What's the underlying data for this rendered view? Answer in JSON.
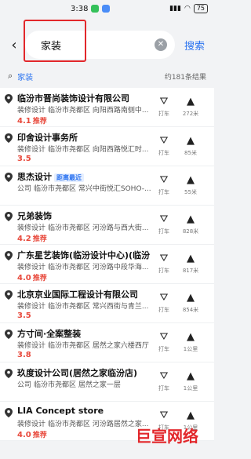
{
  "status_bar": {
    "time": "3:38",
    "battery": "75"
  },
  "search": {
    "query": "家装",
    "button_label": "搜索"
  },
  "suggestion": {
    "keyword": "家装",
    "count_text": "约181条结果"
  },
  "colors": {
    "accent": "#2b73f0",
    "rating": "#e8493c",
    "highlight": "#e2272b"
  },
  "results": [
    {
      "name": "临汾市晋尚装饰设计有限公司",
      "category": "装修设计",
      "address": "临汾市尧都区 向阳西路南侧中...",
      "tag": "",
      "rating": "4.1",
      "rec": "推荐",
      "taxi_label": "打车",
      "distance": "272米"
    },
    {
      "name": "印舍设计事务所",
      "category": "装修设计",
      "address": "临汾市尧都区 向阳西路悦汇时...",
      "tag": "",
      "rating": "3.5",
      "rec": "",
      "taxi_label": "打车",
      "distance": "85米"
    },
    {
      "name": "思杰设计",
      "category": "公司",
      "address": "临汾市尧都区 常兴中街悦汇SOHO-...",
      "tag": "距离最近",
      "rating": "",
      "rec": "",
      "taxi_label": "打车",
      "distance": "55米"
    },
    {
      "name": "兄弟装饰",
      "category": "装修设计",
      "address": "临汾市尧都区 河汾路与西大街...",
      "tag": "",
      "rating": "4.2",
      "rec": "推荐",
      "taxi_label": "打车",
      "distance": "828米"
    },
    {
      "name": "广东星艺装饰(临汾设计中心)(临汾...",
      "category": "装修设计",
      "address": "临汾市尧都区 河汾路中段华海...",
      "tag": "",
      "rating": "4.0",
      "rec": "推荐",
      "taxi_label": "打车",
      "distance": "817米"
    },
    {
      "name": "北京京业国际工程设计有限公司",
      "category": "装修设计",
      "address": "临汾市尧都区 常兴西街与青兰...",
      "tag": "",
      "rating": "3.5",
      "rec": "",
      "taxi_label": "打车",
      "distance": "854米"
    },
    {
      "name": "方寸间·全案整装",
      "category": "装修设计",
      "address": "临汾市尧都区 居然之家六楼西厅",
      "tag": "",
      "rating": "3.8",
      "rec": "",
      "taxi_label": "打车",
      "distance": "1公里"
    },
    {
      "name": "玖度设计公司(居然之家临汾店)",
      "category": "公司",
      "address": "临汾市尧都区 居然之家一层",
      "tag": "",
      "rating": "",
      "rec": "",
      "taxi_label": "打车",
      "distance": "1公里"
    },
    {
      "name": "LIA Concept store",
      "category": "装修设计",
      "address": "临汾市尧都区 河汾路居然之家...",
      "tag": "",
      "rating": "4.0",
      "rec": "推荐",
      "taxi_label": "打车",
      "distance": "1公里"
    }
  ],
  "watermark": "巨宣网络"
}
